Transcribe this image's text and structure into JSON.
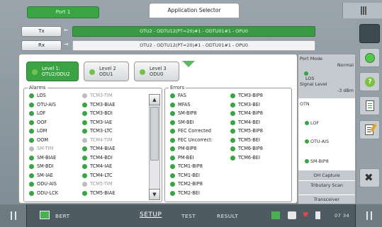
{
  "header": {
    "port_label": "Port 1",
    "app_selector_label": "Application Selector"
  },
  "channels": {
    "tx": {
      "label": "Tx",
      "path": "OTU2 - ODTU12(PT=20)#1 - ODTU01#1 - OPU0"
    },
    "rx": {
      "label": "Rx",
      "path": "OTU2 - ODTU12(PT=20)#1 - ODTU01#1 - OPU0"
    }
  },
  "levels": [
    {
      "line1": "Level 1:",
      "line2": "OTU2/ODU2",
      "active": true
    },
    {
      "line1": "Level 2",
      "line2": "ODU1",
      "active": false
    },
    {
      "line1": "Level 3",
      "line2": "ODU0",
      "active": false
    }
  ],
  "alarms": {
    "title": "Alarms",
    "col1": [
      {
        "label": "LOS",
        "state": "green"
      },
      {
        "label": "OTU-AIS",
        "state": "green"
      },
      {
        "label": "LOF",
        "state": "green"
      },
      {
        "label": "OOF",
        "state": "green"
      },
      {
        "label": "LOM",
        "state": "green"
      },
      {
        "label": "OOM",
        "state": "green"
      },
      {
        "label": "SM-TIM",
        "state": "gray"
      },
      {
        "label": "SM-BIAE",
        "state": "green"
      },
      {
        "label": "SM-BDI",
        "state": "green"
      },
      {
        "label": "SM-IAE",
        "state": "green"
      },
      {
        "label": "ODU-AIS",
        "state": "green"
      },
      {
        "label": "ODU-LCK",
        "state": "green"
      }
    ],
    "col2": [
      {
        "label": "TCM3-TIM",
        "state": "gray"
      },
      {
        "label": "TCM3-BIAE",
        "state": "green"
      },
      {
        "label": "TCM3-BDI",
        "state": "green"
      },
      {
        "label": "TCM3-IAE",
        "state": "green"
      },
      {
        "label": "TCM3-LTC",
        "state": "green"
      },
      {
        "label": "TCM4-TIM",
        "state": "gray"
      },
      {
        "label": "TCM4-BIAE",
        "state": "green"
      },
      {
        "label": "TCM4-BDI",
        "state": "green"
      },
      {
        "label": "TCM4-IAE",
        "state": "green"
      },
      {
        "label": "TCM4-LTC",
        "state": "green"
      },
      {
        "label": "TCM5-TIM",
        "state": "gray"
      },
      {
        "label": "TCM5-BIAE",
        "state": "green"
      }
    ]
  },
  "errors": {
    "title": "Errors",
    "col1": [
      "FAS",
      "MFAS",
      "SM-BIP8",
      "SM-BEI",
      "FEC Corrected",
      "FEC Uncorrect:",
      "PM-BIP8",
      "PM-BEI",
      "TCM1-BIP8",
      "TCM1-BEI",
      "TCM2-BIP8",
      "TCM2-BEI"
    ],
    "col2": [
      "TCM3-BIP8",
      "TCM3-BEI",
      "TCM4-BIP8",
      "TCM4-BEI",
      "TCM5-BIP8",
      "TCM5-BEI",
      "TCM6-BIP8",
      "TCM6-BEI"
    ]
  },
  "right_panel": {
    "port_mode_label": "Port Mode",
    "port_mode_value": "Normal",
    "los_label": "LOS",
    "signal_level_label": "Signal Level",
    "signal_level_value": "-3 dBm",
    "otn_label": "OTN",
    "otn_items": [
      "LOF",
      "OTU-AIS",
      "SM-BIP8"
    ],
    "buttons": [
      "OH Capture",
      "Tributary Scan",
      "Transceiver"
    ]
  },
  "bottom": {
    "bert": "BERT",
    "setup": "SETUP",
    "test": "TEST",
    "result": "RESULT",
    "time": "07 34"
  },
  "colors": {
    "status_green": "#3aa344",
    "status_gray": "#bdbdbd",
    "bar_green": "#3a9a44"
  }
}
